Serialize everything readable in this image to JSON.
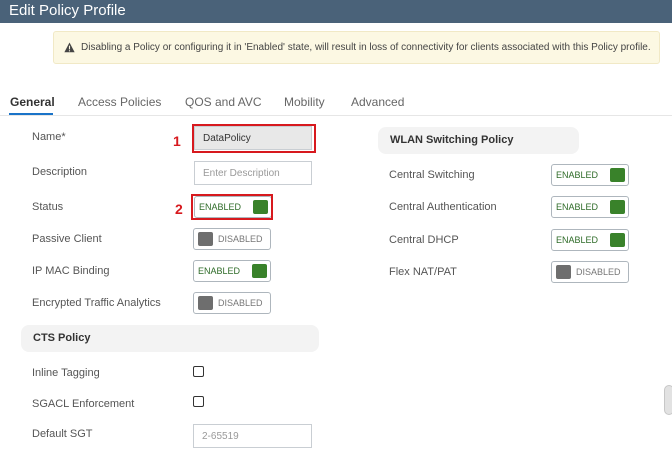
{
  "window": {
    "title": "Edit Policy Profile"
  },
  "warning": {
    "icon": "warning-triangle-icon",
    "text": "Disabling a Policy or configuring it in 'Enabled' state, will result in loss of connectivity for clients associated with this Policy profile."
  },
  "tabs": [
    {
      "label": "General",
      "active": true
    },
    {
      "label": "Access Policies"
    },
    {
      "label": "QOS and AVC"
    },
    {
      "label": "Mobility"
    },
    {
      "label": "Advanced"
    }
  ],
  "general": {
    "name": {
      "label": "Name*",
      "value": "DataPolicy"
    },
    "description": {
      "label": "Description",
      "placeholder": "Enter Description"
    },
    "status": {
      "label": "Status",
      "state": "ENABLED"
    },
    "passive_client": {
      "label": "Passive Client",
      "state": "DISABLED"
    },
    "ip_mac_binding": {
      "label": "IP MAC Binding",
      "state": "ENABLED"
    },
    "encrypted_traffic": {
      "label": "Encrypted Traffic Analytics",
      "state": "DISABLED"
    }
  },
  "cts": {
    "title": "CTS Policy",
    "inline_tagging": {
      "label": "Inline Tagging",
      "checked": false
    },
    "sgacl": {
      "label": "SGACL Enforcement",
      "checked": false
    },
    "default_sgt": {
      "label": "Default SGT",
      "placeholder": "2-65519"
    }
  },
  "wlan": {
    "title": "WLAN Switching Policy",
    "central_switching": {
      "label": "Central Switching",
      "state": "ENABLED"
    },
    "central_auth": {
      "label": "Central Authentication",
      "state": "ENABLED"
    },
    "central_dhcp": {
      "label": "Central DHCP",
      "state": "ENABLED"
    },
    "flex_nat": {
      "label": "Flex NAT/PAT",
      "state": "DISABLED"
    }
  },
  "annotations": {
    "marker1": "1",
    "marker2": "2"
  },
  "colors": {
    "header": "#4a6279",
    "enabled": "#39822a",
    "highlight": "#d7191e",
    "tab_active": "#1a73c8"
  }
}
